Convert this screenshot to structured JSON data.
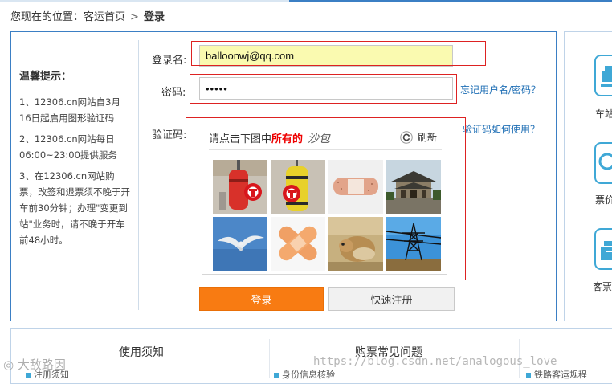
{
  "breadcrumb": {
    "prefix": "您现在的位置：",
    "home": "客运首页",
    "separator": ">",
    "current": "登录"
  },
  "tips": {
    "title": "温馨提示：",
    "items": [
      "1、12306.cn网站自3月16日起启用图形验证码",
      "2、12306.cn网站每日06:00~23:00提供服务",
      "3、在12306.cn网站购票，改签和退票须不晚于开车前30分钟；办理\"变更到站\"业务时，请不晚于开车前48小时。"
    ]
  },
  "form": {
    "username_label": "登录名:",
    "username_value": "balloonwj@qq.com",
    "password_label": "密码:",
    "password_value": "•••••",
    "captcha_label": "验证码:",
    "forgot_link": "忘记用户名/密码？",
    "captcha_help_link": "验证码如何使用？",
    "login_button": "登录",
    "register_button": "快速注册"
  },
  "captcha": {
    "prompt_prefix": "请点击下图中",
    "prompt_keyword": "所有的",
    "prompt_target": "沙包",
    "refresh_label": "刷新",
    "tiles": [
      {
        "subject": "punching-bag-red",
        "selected": true
      },
      {
        "subject": "punching-bag-yellow",
        "selected": true
      },
      {
        "subject": "bandage",
        "selected": false
      },
      {
        "subject": "pagoda-building",
        "selected": false
      },
      {
        "subject": "seagull",
        "selected": false
      },
      {
        "subject": "crossed-bandages",
        "selected": false
      },
      {
        "subject": "hamster",
        "selected": false
      },
      {
        "subject": "power-tower",
        "selected": false
      }
    ]
  },
  "side_panel": {
    "items": [
      {
        "label": "车站",
        "icon": "train-icon"
      },
      {
        "label": "票价",
        "icon": "search-icon"
      },
      {
        "label": "客票",
        "icon": "box-icon"
      }
    ]
  },
  "bottom": {
    "col1_title": "使用须知",
    "col2_title": "购票常见问题",
    "col1_item": "注册须知",
    "col2_item": "身份信息核验",
    "col3_item": "铁路客运规程"
  },
  "watermarks": {
    "left": "大敌路因",
    "right": "https://blog.csdn.net/analogous_love"
  },
  "colors": {
    "accent_blue": "#3b7fc4",
    "login_orange": "#f87b12",
    "highlight_red": "#dd2222",
    "username_bg": "#fafab0"
  }
}
